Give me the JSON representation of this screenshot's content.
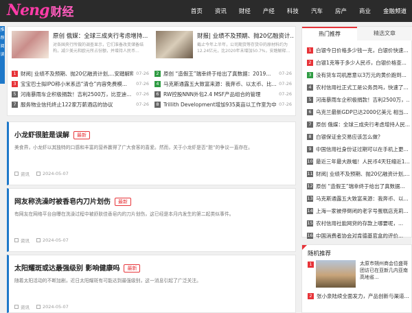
{
  "header": {
    "logo_en": "Neng",
    "logo_cn": "财经",
    "nav": [
      "首页",
      "资讯",
      "财经",
      "产经",
      "科技",
      "汽车",
      "房产",
      "商业",
      "金融频道"
    ]
  },
  "side_tab": [
    "推",
    "荐",
    "阅",
    "读"
  ],
  "featured": [
    {
      "title": "原创 俄媒：全球三成夹行考虑增持...",
      "desc": "对各国央行所做的调查显示，它们准备改变储备结构，减少美元和欧元所占份额，并增持人民币..."
    },
    {
      "title": "财报| 业绩不及预期、抛20亿融资计...",
      "desc": "截止今年上半年，公司期货等存货中的原材料约为12.24亿元，比2020年末增加50.7%，安踏解释..."
    }
  ],
  "top_list": [
    {
      "num": "1",
      "text": "财阅| 业绩不及预期、抛20亿融资计划,...安踏解释...",
      "date": "07-26"
    },
    {
      "num": "2",
      "text": "原创 “造假王”瑞幸终于给出了真数据：2019...",
      "date": "07-26"
    },
    {
      "num": "3",
      "text": "宝宝巴士拟IPO称小米系迅“清仓”内容免费模...",
      "date": "07-26"
    },
    {
      "num": "4",
      "text": "马克斯通露五大致富来源：我奔币、以太币、比...",
      "date": "07-26"
    },
    {
      "num": "5",
      "text": "河南暴雨车企积极捐款！吉利2500万，比亚迪...",
      "date": "07-26"
    },
    {
      "num": "6",
      "text": "RW控股NNN外包2.4 MSF产品组合的管理",
      "date": "07-26"
    },
    {
      "num": "7",
      "text": "服务物业信托终止122家万薪酒店的协议",
      "date": "07-26"
    },
    {
      "num": "8",
      "text": "Trillith Development增加935英亩以工作室为中...",
      "date": "07-26"
    }
  ],
  "articles": [
    {
      "title": "小龙虾很脏是误解",
      "badge": "最新",
      "desc": "美食界，小龙虾以其独特的口感和丰富的营养赢得了广大食客的喜爱。然而，关于小龙虾是否“脏”的争议一直存在。",
      "category": "资讯",
      "date": "2024-05-07"
    },
    {
      "title": "网友称洗澡时被香皂内刀片划伤",
      "badge": "最新",
      "desc": "有网友在网络平台自曝在洗澡过程中被舒肤佳香皂内的刀片划伤，这已经是本月内发生的第二起类似事件。",
      "category": "资讯",
      "date": "2024-05-07"
    },
    {
      "title": "太阳耀斑或达最强级别 影响健康吗",
      "badge": "最新",
      "desc": "随着太阳活动的不断加剧，近日太阳耀斑有可能达到最强级别，这一消息引起了广泛关注。",
      "category": "资讯",
      "date": "2024-05-07"
    }
  ],
  "sidebar": {
    "tabs": [
      "热门推荐",
      "精选文章"
    ],
    "hot": [
      "白银今日价格多少钱一克，白银价快速...",
      "白银1克等于多少人民币，白银价格查...",
      "没有货车司机愿意以3万元的黄价跑到...",
      "农村信用社正式工是公务员吗，快速了...",
      "河南暴雨车企积极捐款！吉利2500万，...",
      "乌克兰最新GDP已达2000亿美元 相当...",
      "原创 俄媒：全球三成央行考虑增持人民...",
      "白银保证金交易应该怎么做？",
      "中国信用社身份证过期可以在手机上更...",
      "最近三年最大跌幅！人民币4天狂缩近1...",
      "财阅| 业绩不及预期、抛20亿融资计划,...",
      "原创 “造假王”瑞幸终于给出了真数据...",
      "马克斯通露五大致富来源：我奔币、以...",
      "上海一家被停倒闭的老字号蛋糕店克莉...",
      "农村信用社能网贷的存款上哪要呢，...",
      "中国消费者协会对肯德基官盒的评价..."
    ],
    "random_title": "随机推荐",
    "random_desc": "太原市朔州商会位盛哥团访已在亚新几内亚南高地省...",
    "random_second": "张小泉陆续全面发力，产品创新与渠道..."
  }
}
